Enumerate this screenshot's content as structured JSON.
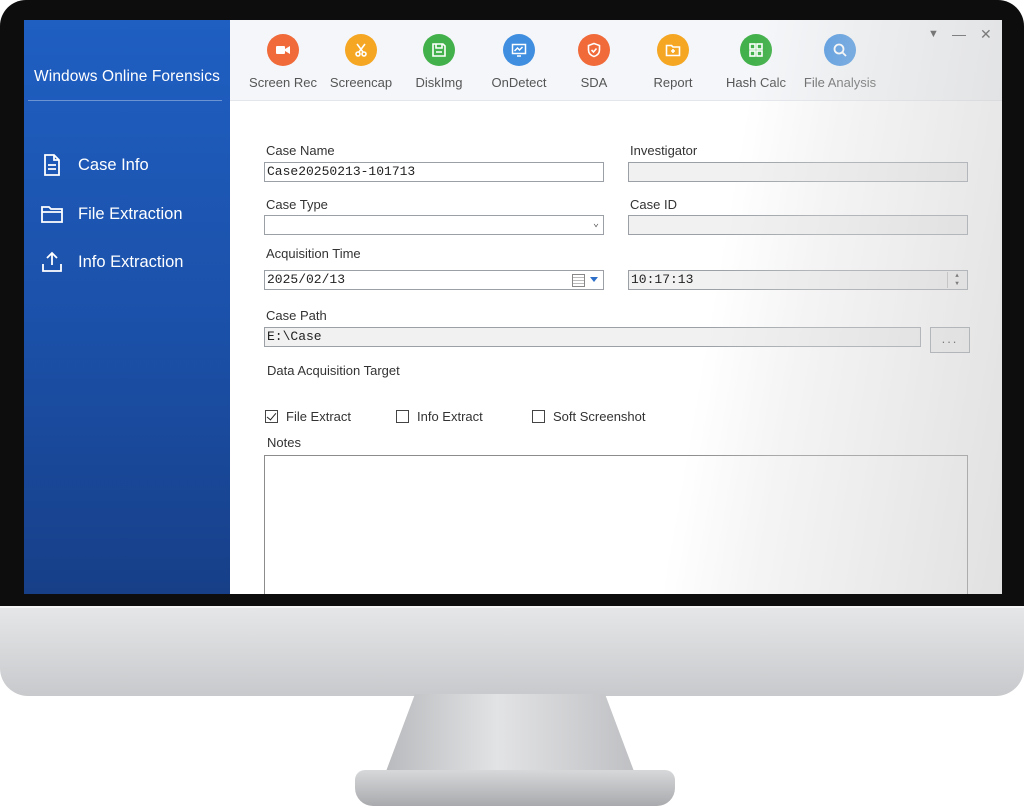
{
  "app": {
    "title": "Windows Online Forensics"
  },
  "sidebar": {
    "items": [
      {
        "label": "Case Info",
        "icon": "document-icon"
      },
      {
        "label": "File Extraction",
        "icon": "folder-icon"
      },
      {
        "label": "Info Extraction",
        "icon": "upload-icon"
      }
    ]
  },
  "toolbar": {
    "items": [
      {
        "label": "Screen Rec",
        "icon": "video-camera-icon",
        "color": "#f06a3a"
      },
      {
        "label": "Screencap",
        "icon": "scissors-icon",
        "color": "#f5a623"
      },
      {
        "label": "DiskImg",
        "icon": "disk-save-icon",
        "color": "#43b14b"
      },
      {
        "label": "OnDetect",
        "icon": "monitor-chart-icon",
        "color": "#3f8ee0"
      },
      {
        "label": "SDA",
        "icon": "shield-icon",
        "color": "#f06a3a"
      },
      {
        "label": "Report",
        "icon": "report-folder-icon",
        "color": "#f5a623"
      },
      {
        "label": "Hash Calc",
        "icon": "grid-icon",
        "color": "#43b14b"
      },
      {
        "label": "File Analysis",
        "icon": "magnifier-icon",
        "color": "#3f8ee0"
      }
    ]
  },
  "window_controls": {
    "menu": "▼",
    "minimize": "—",
    "close": "✕"
  },
  "form": {
    "case_name": {
      "label": "Case Name",
      "value": "Case20250213-101713"
    },
    "investigator": {
      "label": "Investigator",
      "value": ""
    },
    "case_type": {
      "label": "Case Type",
      "value": ""
    },
    "case_id": {
      "label": "Case ID",
      "value": ""
    },
    "acquisition_time": {
      "label": "Acquisition Time",
      "date": "2025/02/13",
      "time": "10:17:13"
    },
    "case_path": {
      "label": "Case Path",
      "value": "E:\\Case",
      "browse": "..."
    },
    "target": {
      "label": "Data Acquisition Target",
      "options": [
        {
          "label": "File Extract",
          "checked": true
        },
        {
          "label": "Info Extract",
          "checked": false
        },
        {
          "label": "Soft Screenshot",
          "checked": false
        }
      ]
    },
    "notes": {
      "label": "Notes",
      "value": ""
    }
  }
}
